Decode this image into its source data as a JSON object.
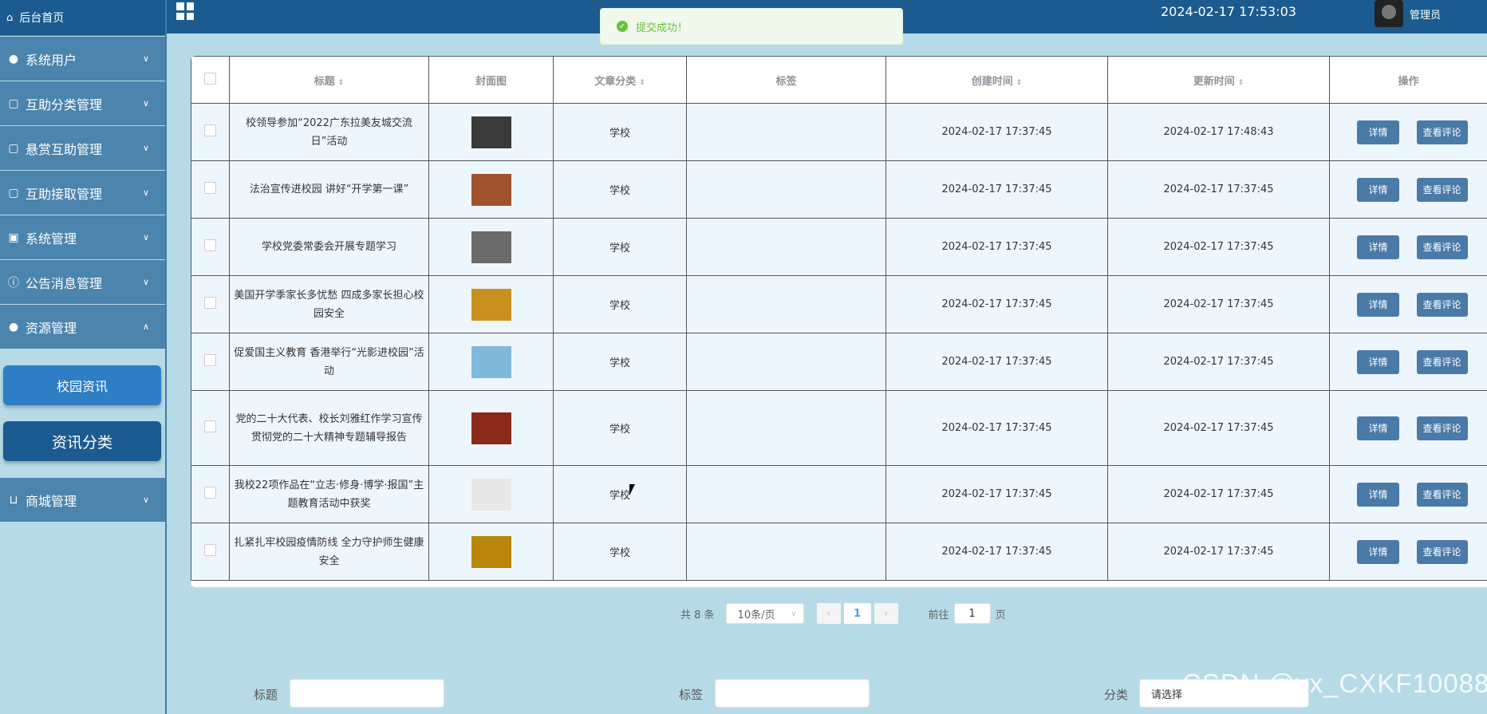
{
  "sidebar": {
    "home": "后台首页",
    "items": [
      {
        "label": "系统用户",
        "icon": "user-icon"
      },
      {
        "label": "互助分类管理",
        "icon": "doc-icon"
      },
      {
        "label": "悬赏互助管理",
        "icon": "doc-icon"
      },
      {
        "label": "互助接取管理",
        "icon": "doc-icon"
      },
      {
        "label": "系统管理",
        "icon": "image-icon"
      },
      {
        "label": "公告消息管理",
        "icon": "info-icon"
      },
      {
        "label": "资源管理",
        "icon": "bulb-icon"
      }
    ],
    "sub": [
      "校园资讯",
      "资讯分类"
    ],
    "shop": "商城管理"
  },
  "header": {
    "datetime": "2024-02-17 17:53:03",
    "user": "管理员"
  },
  "toast": "提交成功！",
  "table": {
    "columns": [
      "标题",
      "封面图",
      "文章分类",
      "标签",
      "创建时间",
      "更新时间",
      "操作"
    ],
    "rows": [
      {
        "title": "校领导参加“2022广东拉美友城交流日”活动",
        "category": "学校",
        "tag": "",
        "created": "2024-02-17 17:37:45",
        "updated": "2024-02-17 17:48:43",
        "cover": "#3a3a3a"
      },
      {
        "title": "法治宣传进校园 讲好“开学第一课”",
        "category": "学校",
        "tag": "",
        "created": "2024-02-17 17:37:45",
        "updated": "2024-02-17 17:37:45",
        "cover": "#a0522d"
      },
      {
        "title": "学校党委常委会开展专题学习",
        "category": "学校",
        "tag": "",
        "created": "2024-02-17 17:37:45",
        "updated": "2024-02-17 17:37:45",
        "cover": "#6b6b6b"
      },
      {
        "title": "美国开学季家长多忧愁 四成多家长担心校园安全",
        "category": "学校",
        "tag": "",
        "created": "2024-02-17 17:37:45",
        "updated": "2024-02-17 17:37:45",
        "cover": "#c8911f"
      },
      {
        "title": "促爱国主义教育 香港举行“光影进校园”活动",
        "category": "学校",
        "tag": "",
        "created": "2024-02-17 17:37:45",
        "updated": "2024-02-17 17:37:45",
        "cover": "#7fb8d8"
      },
      {
        "title": "党的二十大代表、校长刘雅红作学习宣传贯彻党的二十大精神专题辅导报告",
        "category": "学校",
        "tag": "",
        "created": "2024-02-17 17:37:45",
        "updated": "2024-02-17 17:37:45",
        "cover": "#8b2a1a"
      },
      {
        "title": "我校22项作品在“立志·修身·博学·报国”主题教育活动中获奖",
        "category": "学校",
        "tag": "",
        "created": "2024-02-17 17:37:45",
        "updated": "2024-02-17 17:37:45",
        "cover": "#e8e8e8"
      },
      {
        "title": "扎紧扎牢校园疫情防线 全力守护师生健康安全",
        "category": "学校",
        "tag": "",
        "created": "2024-02-17 17:37:45",
        "updated": "2024-02-17 17:37:45",
        "cover": "#b8860b"
      }
    ],
    "detail_btn": "详情",
    "comment_btn": "查看评论"
  },
  "pager": {
    "total": "共 8 条",
    "page_size": "10条/页",
    "current": "1",
    "goto": "前往",
    "goto_value": "1",
    "page_unit": "页"
  },
  "form": {
    "title_label": "标题",
    "tag_label": "标签",
    "category_label": "分类",
    "category_placeholder": "请选择"
  },
  "watermark": "CSDN @vx_CXKF10088"
}
